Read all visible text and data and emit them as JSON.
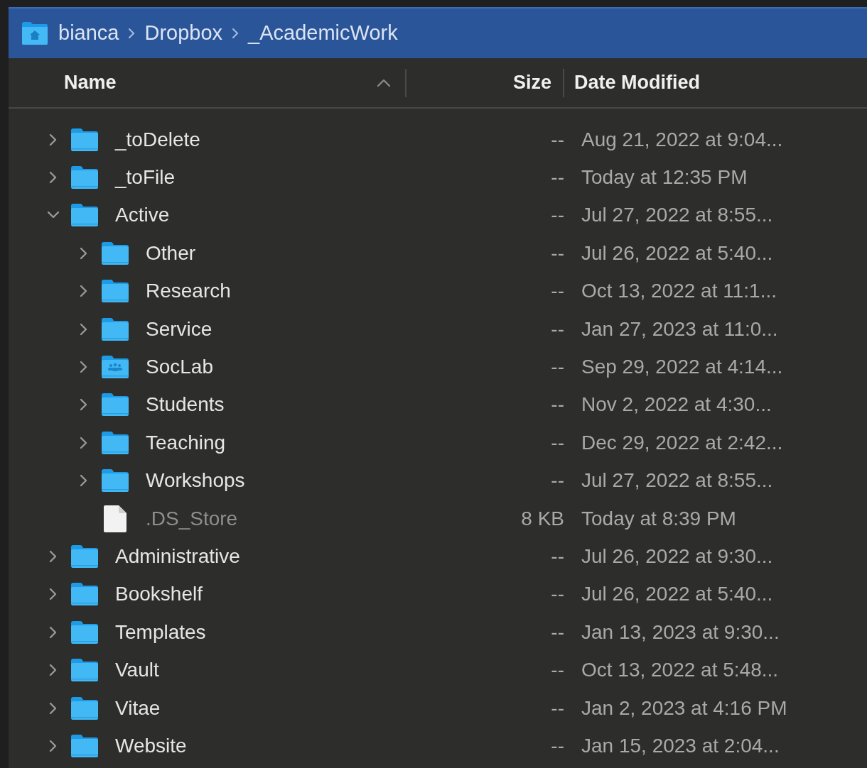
{
  "path_bar": {
    "crumbs": [
      "bianca",
      "Dropbox",
      "_AcademicWork"
    ]
  },
  "columns": [
    {
      "label": "Name",
      "sorted": true
    },
    {
      "label": "Size",
      "sorted": false
    },
    {
      "label": "Date Modified",
      "sorted": false
    }
  ],
  "rows": [
    {
      "kind": "folder",
      "name": "_toDelete",
      "size": "--",
      "date": "Aug 21, 2022 at 9:04...",
      "expanded": false
    },
    {
      "kind": "folder",
      "name": "_toFile",
      "size": "--",
      "date": "Today at 12:35 PM",
      "expanded": false
    },
    {
      "kind": "folder",
      "name": "Active",
      "size": "--",
      "date": "Jul 27, 2022 at 8:55...",
      "expanded": true,
      "children": [
        {
          "kind": "folder",
          "name": "Other",
          "size": "--",
          "date": "Jul 26, 2022 at 5:40...",
          "expanded": false
        },
        {
          "kind": "folder",
          "name": "Research",
          "size": "--",
          "date": "Oct 13, 2022 at 11:1...",
          "expanded": false
        },
        {
          "kind": "folder",
          "name": "Service",
          "size": "--",
          "date": "Jan 27, 2023 at 11:0...",
          "expanded": false
        },
        {
          "kind": "shared-folder",
          "name": "SocLab",
          "size": "--",
          "date": "Sep 29, 2022 at 4:14...",
          "expanded": false
        },
        {
          "kind": "folder",
          "name": "Students",
          "size": "--",
          "date": "Nov 2, 2022 at 4:30...",
          "expanded": false
        },
        {
          "kind": "folder",
          "name": "Teaching",
          "size": "--",
          "date": "Dec 29, 2022 at 2:42...",
          "expanded": false
        },
        {
          "kind": "folder",
          "name": "Workshops",
          "size": "--",
          "date": "Jul 27, 2022 at 8:55...",
          "expanded": false
        },
        {
          "kind": "file",
          "name": ".DS_Store",
          "size": "8 KB",
          "date": "Today at 8:39 PM"
        }
      ]
    },
    {
      "kind": "folder",
      "name": "Administrative",
      "size": "--",
      "date": "Jul 26, 2022 at 9:30...",
      "expanded": false
    },
    {
      "kind": "folder",
      "name": "Bookshelf",
      "size": "--",
      "date": "Jul 26, 2022 at 5:40...",
      "expanded": false
    },
    {
      "kind": "folder",
      "name": "Templates",
      "size": "--",
      "date": "Jan 13, 2023 at 9:30...",
      "expanded": false
    },
    {
      "kind": "folder",
      "name": "Vault",
      "size": "--",
      "date": "Oct 13, 2022 at 5:48...",
      "expanded": false
    },
    {
      "kind": "folder",
      "name": "Vitae",
      "size": "--",
      "date": "Jan 2, 2023 at 4:16 PM",
      "expanded": false
    },
    {
      "kind": "folder",
      "name": "Website",
      "size": "--",
      "date": "Jan 15, 2023 at 2:04...",
      "expanded": false
    }
  ]
}
